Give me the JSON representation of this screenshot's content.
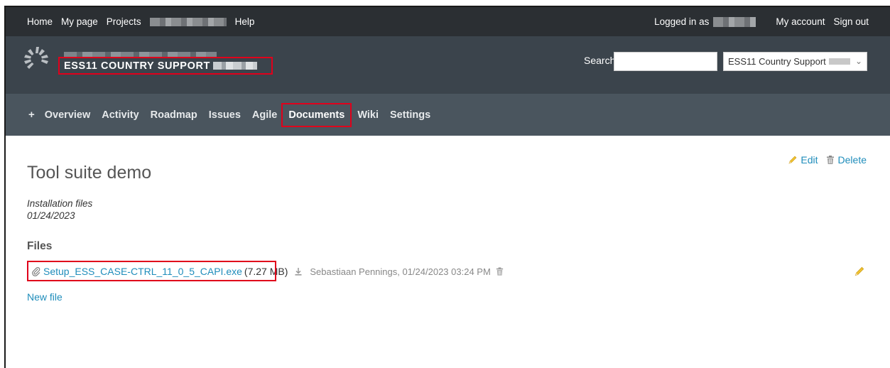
{
  "top_menu": {
    "items": [
      "Home",
      "My page",
      "Projects"
    ],
    "help": "Help",
    "logged_in_label": "Logged in as",
    "my_account": "My account",
    "sign_out": "Sign out"
  },
  "header": {
    "project_title": "ESS11 COUNTRY SUPPORT",
    "search_label": "Search:",
    "search_value": "",
    "project_select_value": "ESS11 Country Support"
  },
  "main_menu": {
    "plus": "+",
    "tabs": [
      "Overview",
      "Activity",
      "Roadmap",
      "Issues",
      "Agile"
    ],
    "active_tab": "Documents",
    "tabs_after": [
      "Wiki",
      "Settings"
    ]
  },
  "document": {
    "edit_label": "Edit",
    "delete_label": "Delete",
    "title": "Tool suite demo",
    "category": "Installation files",
    "date": "01/24/2023",
    "files_heading": "Files",
    "file": {
      "name": "Setup_ESS_CASE-CTRL_11_0_5_CAPI.exe",
      "size": "(7.27 MB)",
      "author_date": "Sebastiaan Pennings, 01/24/2023 03:24 PM"
    },
    "new_file_label": "New file"
  },
  "colors": {
    "top_bar": "#2b2f33",
    "header": "#3b444c",
    "main_menu": "#4a555e",
    "link": "#1f8dbb",
    "highlight": "#e0001b"
  }
}
